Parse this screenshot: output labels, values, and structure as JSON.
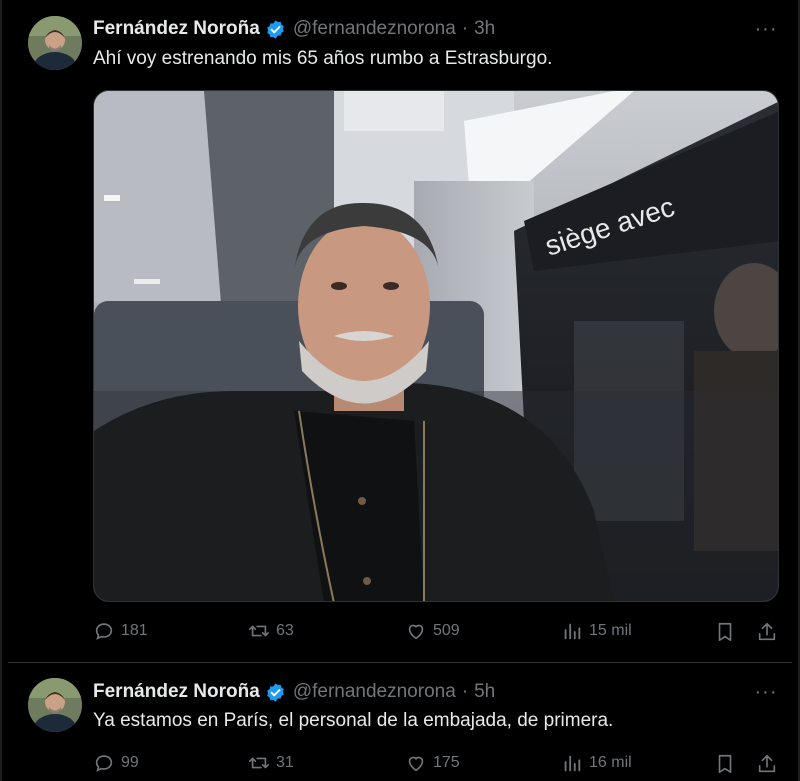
{
  "tweets": [
    {
      "name": "Fernández Noroña",
      "handle": "@fernandeznorona",
      "time": "3h",
      "text": "Ahí voy estrenando mis 65 años rumbo a Estrasburgo.",
      "replies": "181",
      "retweets": "63",
      "likes": "509",
      "views": "15 mil"
    },
    {
      "name": "Fernández Noroña",
      "handle": "@fernandeznorona",
      "time": "5h",
      "text": "Ya estamos en París, el personal de la embajada, de primera.",
      "replies": "99",
      "retweets": "31",
      "likes": "175",
      "views": "16 mil"
    }
  ],
  "separator": "·",
  "more_label": "···",
  "colors": {
    "background": "#000000",
    "text": "#e7e9ea",
    "secondary": "#71767b",
    "verified": "#1d9bf0",
    "divider": "#2f3336"
  },
  "icons": [
    "verified-badge-icon",
    "more-icon",
    "reply-icon",
    "retweet-icon",
    "like-icon",
    "views-icon",
    "bookmark-icon",
    "share-icon"
  ]
}
